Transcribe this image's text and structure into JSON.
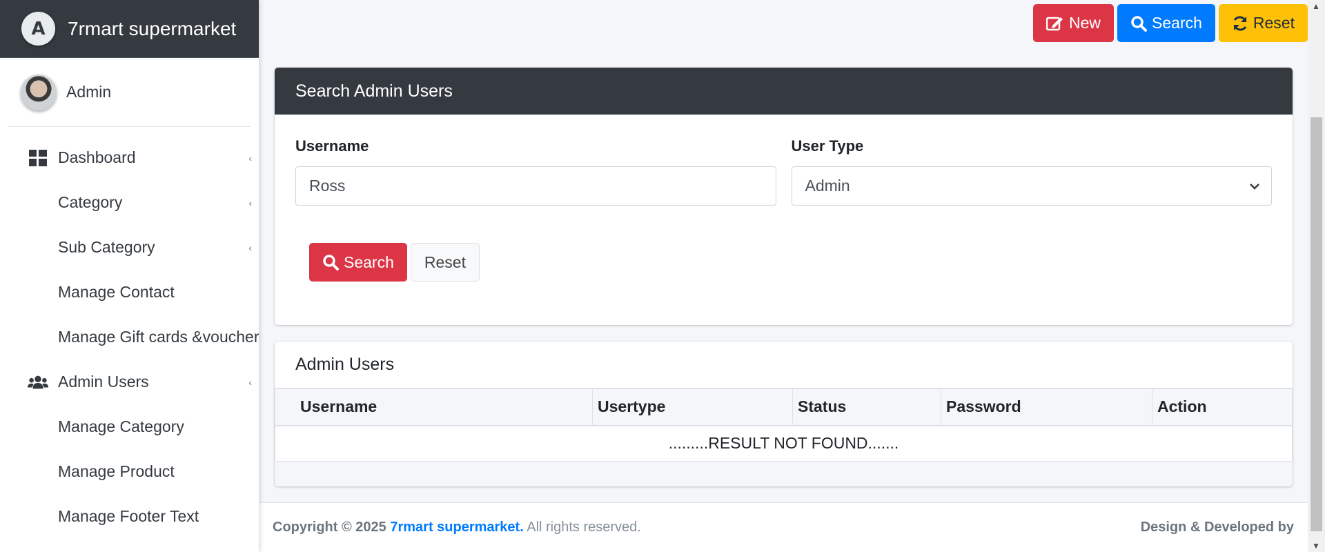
{
  "brand": {
    "name": "7rmart supermarket",
    "logo_letter": "A"
  },
  "user": {
    "name": "Admin"
  },
  "sidebar": {
    "items": [
      {
        "label": "Dashboard",
        "icon": "dashboard-icon",
        "chevron": "‹"
      },
      {
        "label": "Category",
        "icon": "",
        "chevron": "‹"
      },
      {
        "label": "Sub Category",
        "icon": "",
        "chevron": "‹"
      },
      {
        "label": "Manage Contact",
        "icon": "",
        "chevron": ""
      },
      {
        "label": "Manage Gift cards &voucher",
        "icon": "",
        "chevron": ""
      },
      {
        "label": "Admin Users",
        "icon": "users-icon",
        "chevron": "‹"
      },
      {
        "label": "Manage Category",
        "icon": "",
        "chevron": ""
      },
      {
        "label": "Manage Product",
        "icon": "",
        "chevron": ""
      },
      {
        "label": "Manage Footer Text",
        "icon": "",
        "chevron": ""
      }
    ]
  },
  "toolbar": {
    "new_label": "New",
    "search_label": "Search",
    "reset_label": "Reset"
  },
  "search_card": {
    "title": "Search Admin Users",
    "username_label": "Username",
    "username_value": "Ross",
    "usertype_label": "User Type",
    "usertype_value": "Admin",
    "search_button": "Search",
    "reset_button": "Reset"
  },
  "results_card": {
    "title": "Admin Users",
    "columns": [
      "Username",
      "Usertype",
      "Status",
      "Password",
      "Action"
    ],
    "empty_message": ".........RESULT NOT FOUND......."
  },
  "footer": {
    "copyright_prefix": "Copyright © 2025",
    "brand": "7rmart supermarket.",
    "rights": "All rights reserved.",
    "right_text": "Design & Developed by"
  },
  "colors": {
    "primary": "#007bff",
    "danger": "#dc3545",
    "warning": "#ffc107",
    "dark": "#343a40"
  }
}
